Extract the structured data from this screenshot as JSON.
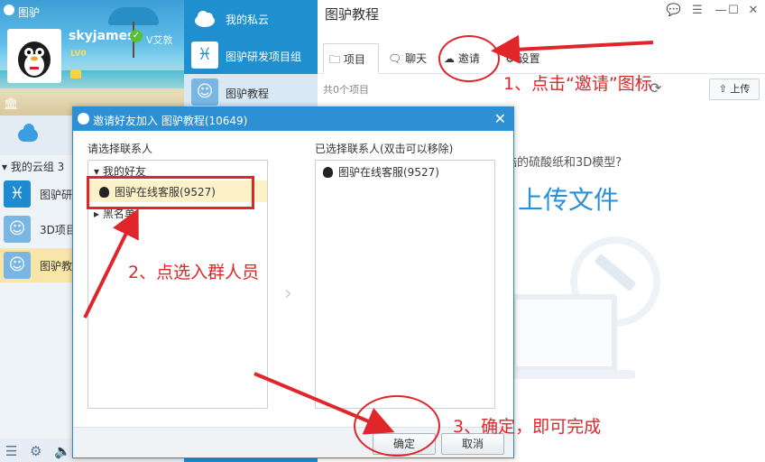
{
  "app": {
    "title": "图驴",
    "username": "skyjames",
    "level_badge": "LV0",
    "vip_badge": "✓",
    "watermark": "V艾敦"
  },
  "cloud_nav": {
    "label": "我的私云"
  },
  "group_header": "▾ 我的云组 3",
  "left_groups": [
    {
      "label": "图驴研",
      "icon": "pisces-icon",
      "color": "#1e8ad0"
    },
    {
      "label": "3D项目",
      "icon": "ghost-avatar-icon",
      "color": "#79b6e3"
    },
    {
      "label": "图驴教",
      "icon": "ghost-avatar-icon",
      "color": "#79b6e3"
    }
  ],
  "mid_groups": [
    {
      "label": "我的私云",
      "icon": "cloud-icon"
    },
    {
      "label": "图驴研发项目组",
      "icon": "pisces-icon"
    },
    {
      "label": "图驴教程",
      "icon": "ghost-avatar-icon"
    }
  ],
  "right": {
    "title": "图驴教程",
    "tabs": [
      {
        "label": "项目",
        "icon": "folder-icon"
      },
      {
        "label": "聊天",
        "icon": "chat-icon"
      },
      {
        "label": "邀请",
        "icon": "cloud-plus-icon"
      },
      {
        "label": "设置",
        "icon": "gear-icon"
      }
    ],
    "items_count": "共0个项目",
    "upload_label": "上传",
    "empty_hint": "酷的硫酸纸和3D模型?",
    "empty_upload": "上传文件"
  },
  "dialog": {
    "title": "邀请好友加入 图驴教程(10649)",
    "left_label": "请选择联系人",
    "right_label": "已选择联系人(双击可以移除)",
    "tree": [
      {
        "label": "我的好友",
        "contacts": [
          "图驴在线客服(9527)"
        ]
      },
      {
        "label": "黑名单",
        "contacts": []
      }
    ],
    "selected": [
      "图驴在线客服(9527)"
    ],
    "ok_label": "确定",
    "cancel_label": "取消"
  },
  "annotations": {
    "step1": "1、点击“邀请”图标",
    "step2": "2、点选入群人员",
    "step3": "3、确定，即可完成"
  },
  "colors": {
    "accent": "#1f8fd0",
    "annotation": "#e0262a",
    "dialog_title": "#2d8fd4"
  }
}
